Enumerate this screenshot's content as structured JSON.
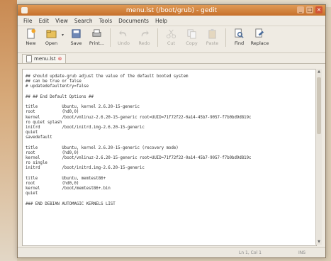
{
  "window": {
    "title": "menu.lst (/boot/grub) - gedit"
  },
  "menubar": [
    "File",
    "Edit",
    "View",
    "Search",
    "Tools",
    "Documents",
    "Help"
  ],
  "toolbar": [
    {
      "label": "New",
      "icon": "new-document-icon",
      "enabled": true
    },
    {
      "label": "Open",
      "icon": "open-folder-icon",
      "enabled": true
    },
    {
      "label": "Save",
      "icon": "save-icon",
      "enabled": true
    },
    {
      "label": "Print...",
      "icon": "print-icon",
      "enabled": true
    },
    {
      "label": "Undo",
      "icon": "undo-icon",
      "enabled": false
    },
    {
      "label": "Redo",
      "icon": "redo-icon",
      "enabled": false
    },
    {
      "label": "Cut",
      "icon": "cut-icon",
      "enabled": false
    },
    {
      "label": "Copy",
      "icon": "copy-icon",
      "enabled": false
    },
    {
      "label": "Paste",
      "icon": "paste-icon",
      "enabled": false
    },
    {
      "label": "Find",
      "icon": "find-icon",
      "enabled": true
    },
    {
      "label": "Replace",
      "icon": "replace-icon",
      "enabled": true
    }
  ],
  "tab": {
    "label": "menu.lst"
  },
  "editor": {
    "lines": [
      "## should update-grub adjust the value of the default booted system",
      "## can be true or false",
      "# updatedefaultentry=false",
      "",
      "## ## End Default Options ##",
      "",
      "title          Ubuntu, kernel 2.6.20-15-generic",
      "root           (hd0,0)",
      "kernel         /boot/vmlinuz-2.6.20-15-generic root=UUID=71f72f22-0a14-45b7-9057-f7b0bd9d819c",
      "ro quiet splash",
      "initrd         /boot/initrd.img-2.6.20-15-generic",
      "quiet",
      "savedefault",
      "",
      "title          Ubuntu, kernel 2.6.20-15-generic (recovery mode)",
      "root           (hd0,0)",
      "kernel         /boot/vmlinuz-2.6.20-15-generic root=UUID=71f72f22-0a14-45b7-9057-f7b0bd9d819c",
      "ro single",
      "initrd         /boot/initrd.img-2.6.20-15-generic",
      "",
      "title          Ubuntu, memtest86+",
      "root           (hd0,0)",
      "kernel         /boot/memtest86+.bin",
      "quiet",
      "",
      "### END DEBIAN AUTOMAGIC KERNELS LIST"
    ]
  },
  "statusbar": {
    "position": "Ln 1, Col 1",
    "mode": "INS"
  }
}
